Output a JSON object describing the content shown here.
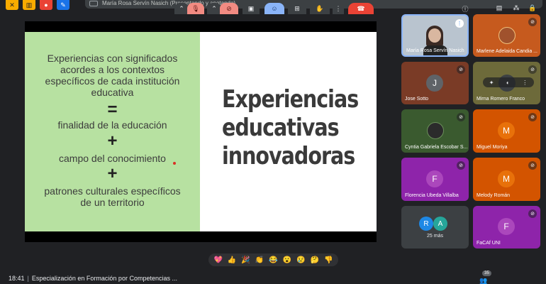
{
  "colors": {
    "background": "#202124",
    "slide_left": "#b7e1a1",
    "hangup": "#ea4335",
    "muted_control": "#f28b82",
    "active_control": "#8ab4f8"
  },
  "header": {
    "presenting_text": "María Rosa Servín Nasich (Presentando y anotando)"
  },
  "slide": {
    "left_lines": [
      "Experiencias con significados",
      "acordes a los contextos",
      "específicos de cada institución",
      "educativa",
      "finalidad de la educación",
      "campo del conocimiento",
      "patrones culturales específicos",
      "de un territorio"
    ],
    "operators": [
      "=",
      "+",
      "+"
    ],
    "title_lines": [
      "Experiencias",
      "educativas",
      "innovadoras"
    ]
  },
  "participants": [
    {
      "name": "María Rosa Servín Nasich",
      "initial": "",
      "speaking": true
    },
    {
      "name": "Marlene Adelaida Candia ...",
      "initial": ""
    },
    {
      "name": "Jose Sotto",
      "initial": "J"
    },
    {
      "name": "Mirna Romero Franco",
      "initial": ""
    },
    {
      "name": "Cyntia Gabriela Escobar S...",
      "initial": ""
    },
    {
      "name": "Miguel Moriya",
      "initial": "M"
    },
    {
      "name": "Florencia Ubeda Villalba",
      "initial": "F"
    },
    {
      "name": "Melody Román",
      "initial": "M"
    },
    {
      "name": "25 más",
      "initials": [
        "R",
        "A"
      ]
    },
    {
      "name": "FaCAf UNI",
      "initial": "F"
    }
  ],
  "reactions": [
    "💖",
    "👍",
    "🎉",
    "👏",
    "😂",
    "😮",
    "😢",
    "🤔",
    "👎"
  ],
  "bottom": {
    "time": "18:41",
    "meeting_title": "Especialización en Formación por Competencias ...",
    "participant_count": "35"
  }
}
